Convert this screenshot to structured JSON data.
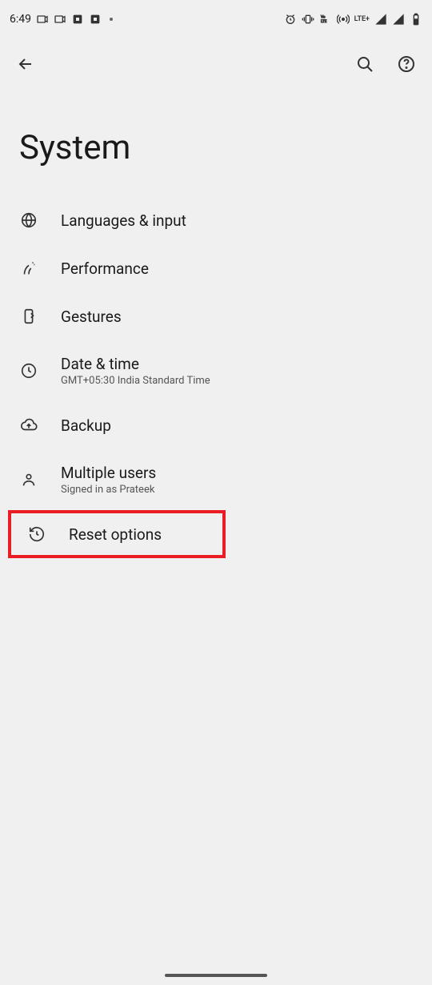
{
  "status": {
    "time": "6:49",
    "lte": "LTE+"
  },
  "header": {
    "title": "System"
  },
  "items": [
    {
      "icon": "globe-icon",
      "title": "Languages & input",
      "sub": null
    },
    {
      "icon": "performance-icon",
      "title": "Performance",
      "sub": null
    },
    {
      "icon": "gestures-icon",
      "title": "Gestures",
      "sub": null
    },
    {
      "icon": "clock-icon",
      "title": "Date & time",
      "sub": "GMT+05:30 India Standard Time"
    },
    {
      "icon": "cloud-upload-icon",
      "title": "Backup",
      "sub": null
    },
    {
      "icon": "person-icon",
      "title": "Multiple users",
      "sub": "Signed in as Prateek"
    },
    {
      "icon": "history-icon",
      "title": "Reset options",
      "sub": null,
      "highlighted": true
    }
  ]
}
